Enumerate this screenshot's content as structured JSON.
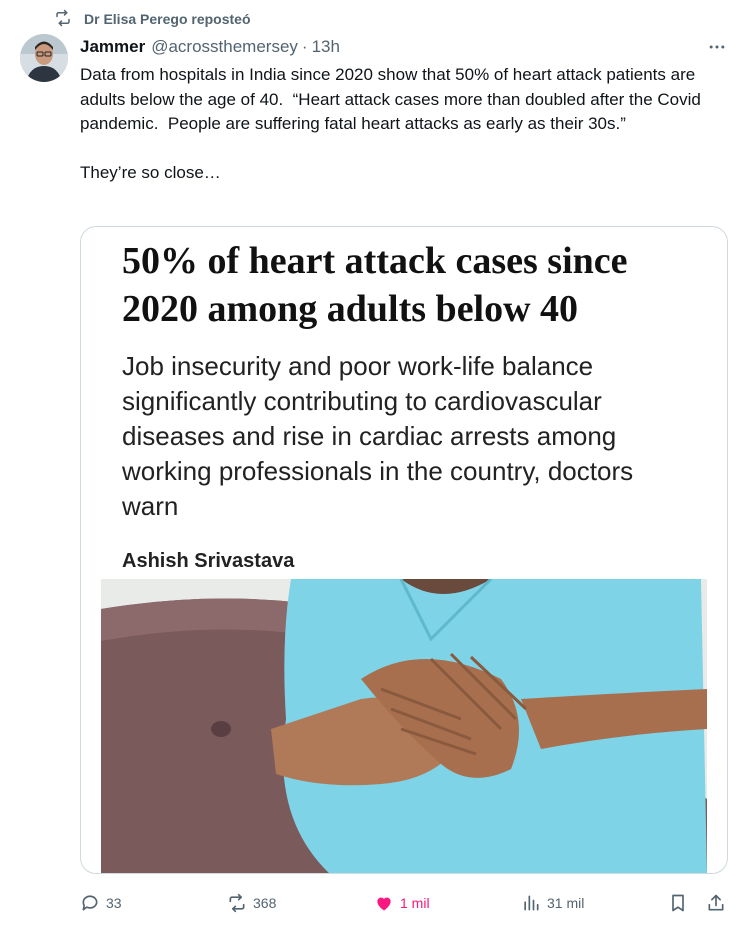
{
  "repost": {
    "icon": "repost-icon",
    "label": "Dr Elisa Perego reposteó"
  },
  "tweet": {
    "author_name": "Jammer",
    "handle": "@acrossthemersey",
    "separator": "·",
    "time": "13h",
    "text": "Data from hospitals in India since 2020 show that 50% of heart attack patients are adults below the age of 40.  “Heart attack cases more than doubled after the Covid pandemic.  People are suffering fatal heart attacks as early as their 30s.”\n\nThey’re so close…"
  },
  "card": {
    "headline": "50% of heart attack cases since 2020 among adults below 40",
    "dek": "Job insecurity and poor work-life balance significantly contributing to cardiovascular diseases and rise in cardiac arrests among working professionals in the country, doctors warn",
    "author": "Ashish Srivastava",
    "image_description": "man-clutching-chest-photo"
  },
  "actions": {
    "reply_count": "33",
    "repost_count": "368",
    "like_count": "1 mil",
    "views_count": "31 mil"
  },
  "colors": {
    "secondary_text": "#536471",
    "like_pink": "#f91880",
    "border": "#cfd9de",
    "shirt": "#7fd3e6"
  }
}
